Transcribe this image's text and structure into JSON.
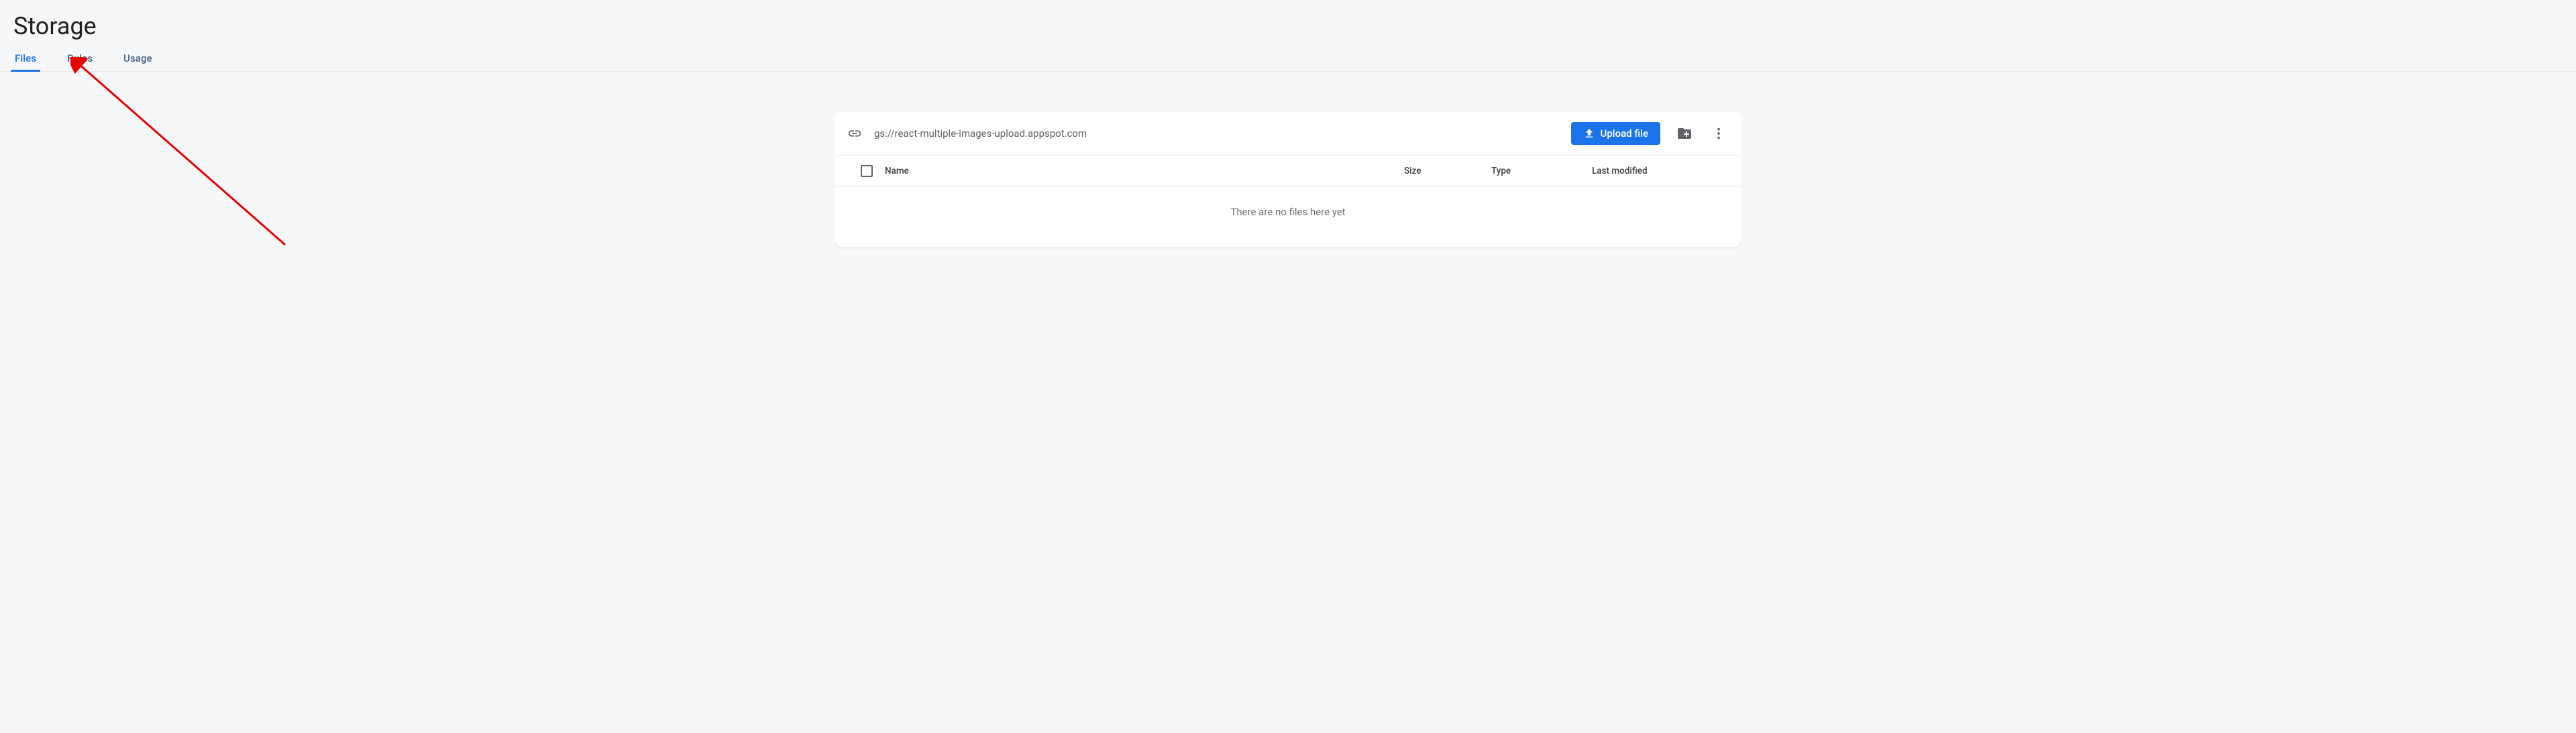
{
  "header": {
    "title": "Storage"
  },
  "tabs": [
    {
      "label": "Files",
      "active": true
    },
    {
      "label": "Rules",
      "active": false
    },
    {
      "label": "Usage",
      "active": false
    }
  ],
  "toolbar": {
    "bucket_path": "gs://react-multiple-images-upload.appspot.com",
    "upload_label": "Upload file"
  },
  "table": {
    "columns": {
      "name": "Name",
      "size": "Size",
      "type": "Type",
      "modified": "Last modified"
    },
    "empty_message": "There are no files here yet"
  },
  "colors": {
    "primary": "#1a73e8",
    "text": "#3c4043",
    "muted": "#5f6368",
    "background": "#f6f7f9"
  }
}
